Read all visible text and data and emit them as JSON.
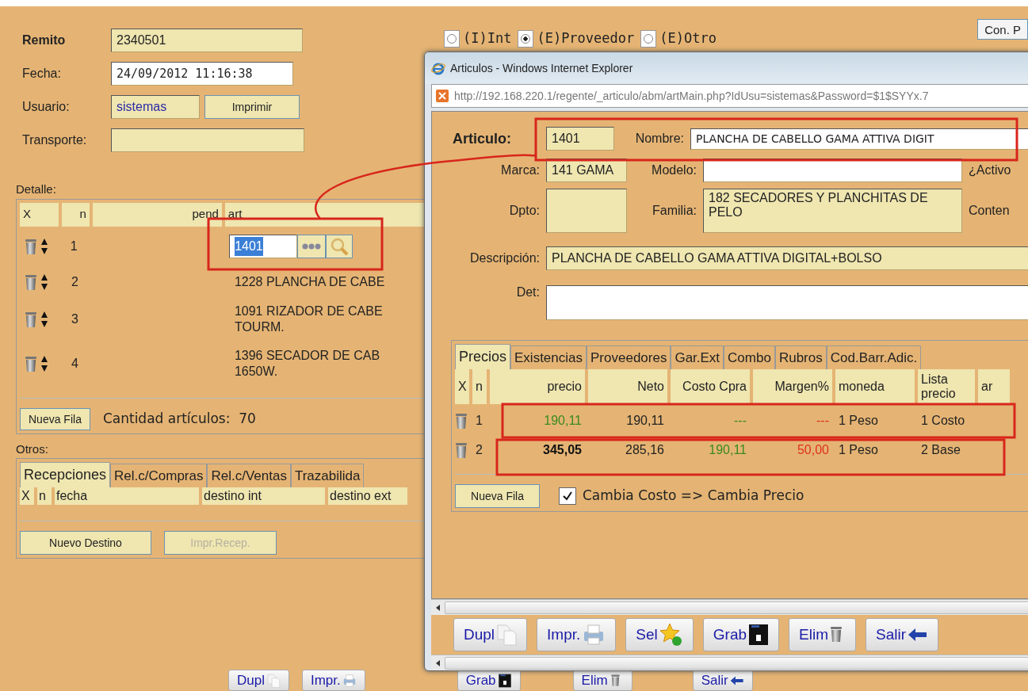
{
  "form": {
    "remito_label": "Remito",
    "remito": "2340501",
    "fecha_label": "Fecha:",
    "fecha": "24/09/2012 11:16:38",
    "usuario_label": "Usuario:",
    "usuario": "sistemas",
    "imprimir": "Imprimir",
    "transporte_label": "Transporte:"
  },
  "origin_options": [
    {
      "label": "(I)Int",
      "selected": false
    },
    {
      "label": "(E)Proveedor",
      "selected": true
    },
    {
      "label": "(E)Otro",
      "selected": false
    }
  ],
  "side_button": "Con. P",
  "detalle": {
    "title": "Detalle:",
    "columns": [
      "X",
      "n",
      "pend",
      "art"
    ],
    "rows": [
      {
        "kind": "input",
        "n": "1",
        "art": "1401"
      },
      {
        "kind": "text",
        "n": "2",
        "art": [
          "1228 PLANCHA DE CABE"
        ]
      },
      {
        "kind": "text",
        "n": "3",
        "art": [
          "1091 RIZADOR DE CABE",
          "TOURM."
        ]
      },
      {
        "kind": "text",
        "n": "4",
        "art": [
          "1396 SECADOR DE CAB",
          "1650W."
        ]
      }
    ],
    "new_row": "Nueva Fila",
    "count": "Cantidad artículos:  70"
  },
  "otros": {
    "title": "Otros:",
    "tabs": [
      {
        "label": "Recepciones",
        "selected": true
      },
      {
        "label": "Rel.c/Compras",
        "selected": false
      },
      {
        "label": "Rel.c/Ventas",
        "selected": false
      },
      {
        "label": "Trazabilida",
        "selected": false
      }
    ],
    "columns": [
      "X",
      "n",
      "fecha",
      "destino int",
      "destino ext"
    ],
    "buttons": [
      {
        "label": "Nuevo Destino",
        "disabled": false
      },
      {
        "label": "Impr.Recep.",
        "disabled": true
      }
    ]
  },
  "footer_buttons": [
    "Dupl",
    "Impr.",
    "Grab",
    "Elim",
    "Salir"
  ],
  "popup": {
    "title": "Articulos - Windows Internet Explorer",
    "url": "http://192.168.220.1/regente/_articulo/abm/artMain.php?IdUsu=sistemas&Password=$1$SYYx.7",
    "articulo_label": "Articulo:",
    "articulo": "1401",
    "nombre_label": "Nombre:",
    "nombre": "PLANCHA DE CABELLO GAMA ATTIVA DIGIT",
    "marca_label": "Marca:",
    "marca": "141 GAMA",
    "modelo_label": "Modelo:",
    "activo_label": "¿Activo",
    "dpto_label": "Dpto:",
    "familia_label": "Familia:",
    "familia": "182 SECADORES Y PLANCHITAS DE PELO",
    "conten_label": "Conten",
    "descripcion_label": "Descripción:",
    "descripcion": "PLANCHA DE CABELLO GAMA ATTIVA DIGITAL+BOLSO",
    "det_label": "Det:",
    "tabs": [
      {
        "label": "Precios",
        "selected": true
      },
      {
        "label": "Existencias",
        "selected": false
      },
      {
        "label": "Proveedores",
        "selected": false
      },
      {
        "label": "Gar.Ext",
        "selected": false
      },
      {
        "label": "Combo",
        "selected": false
      },
      {
        "label": "Rubros",
        "selected": false
      },
      {
        "label": "Cod.Barr.Adic.",
        "selected": false
      }
    ],
    "columns": [
      "X",
      "n",
      "precio",
      "Neto",
      "Costo Cpra",
      "Margen%",
      "moneda",
      "Lista precio",
      "ar"
    ],
    "rows": [
      {
        "n": "1",
        "precio": "190,11",
        "precio_bold": false,
        "neto": "190,11",
        "costo": "---",
        "margen": "---",
        "moneda": "1 Peso",
        "lista": "1 Costo"
      },
      {
        "n": "2",
        "precio": "345,05",
        "precio_bold": true,
        "neto": "285,16",
        "costo": "190,11",
        "margen": "50,00",
        "moneda": "1 Peso",
        "lista": "2 Base"
      }
    ],
    "new_row": "Nueva Fila",
    "cambia": {
      "label": "Cambia Costo => Cambia Precio",
      "checked": true
    },
    "buttons": [
      "Dupl",
      "Impr.",
      "Sel",
      "Grab",
      "Elim",
      "Salir"
    ]
  }
}
